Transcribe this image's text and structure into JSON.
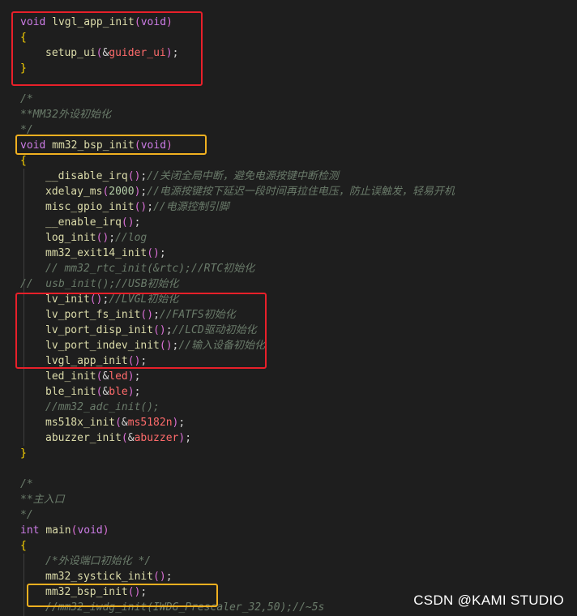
{
  "lines": [
    {
      "indent": 0,
      "tokens": [
        [
          "kw",
          "void"
        ],
        [
          "pl",
          " "
        ],
        [
          "fn",
          "lvgl_app_init"
        ],
        [
          "pn",
          "("
        ],
        [
          "kw",
          "void"
        ],
        [
          "pn",
          ")"
        ]
      ]
    },
    {
      "indent": 0,
      "tokens": [
        [
          "br",
          "{"
        ]
      ]
    },
    {
      "indent": 1,
      "tokens": [
        [
          "fn",
          "setup_ui"
        ],
        [
          "pn",
          "("
        ],
        [
          "pl",
          "&"
        ],
        [
          "var",
          "guider_ui"
        ],
        [
          "pn",
          ")"
        ],
        [
          "pl",
          ";"
        ]
      ]
    },
    {
      "indent": 0,
      "tokens": [
        [
          "br",
          "}"
        ]
      ]
    },
    {
      "indent": 0,
      "tokens": []
    },
    {
      "indent": 0,
      "tokens": [
        [
          "cm",
          "/*"
        ]
      ]
    },
    {
      "indent": 0,
      "tokens": [
        [
          "cm",
          "**MM32外设初始化"
        ]
      ]
    },
    {
      "indent": 0,
      "tokens": [
        [
          "cm",
          "*/"
        ]
      ]
    },
    {
      "indent": 0,
      "tokens": [
        [
          "kw",
          "void"
        ],
        [
          "pl",
          " "
        ],
        [
          "fn",
          "mm32_bsp_init"
        ],
        [
          "pn",
          "("
        ],
        [
          "kw",
          "void"
        ],
        [
          "pn",
          ")"
        ]
      ]
    },
    {
      "indent": 0,
      "tokens": [
        [
          "br",
          "{"
        ]
      ]
    },
    {
      "indent": 1,
      "tokens": [
        [
          "fn",
          "__disable_irq"
        ],
        [
          "pn",
          "()"
        ],
        [
          "pl",
          ";"
        ],
        [
          "cm",
          "//关闭全局中断，避免电源按键中断检测"
        ]
      ]
    },
    {
      "indent": 1,
      "tokens": [
        [
          "fn",
          "xdelay_ms"
        ],
        [
          "pn",
          "("
        ],
        [
          "num",
          "2000"
        ],
        [
          "pn",
          ")"
        ],
        [
          "pl",
          ";"
        ],
        [
          "cm",
          "//电源按键按下延迟一段时间再拉住电压，防止误触发，轻易开机"
        ]
      ]
    },
    {
      "indent": 1,
      "tokens": [
        [
          "fn",
          "misc_gpio_init"
        ],
        [
          "pn",
          "()"
        ],
        [
          "pl",
          ";"
        ],
        [
          "cm",
          "//电源控制引脚"
        ]
      ]
    },
    {
      "indent": 1,
      "tokens": [
        [
          "fn",
          "__enable_irq"
        ],
        [
          "pn",
          "()"
        ],
        [
          "pl",
          ";"
        ]
      ]
    },
    {
      "indent": 1,
      "tokens": [
        [
          "fn",
          "log_init"
        ],
        [
          "pn",
          "()"
        ],
        [
          "pl",
          ";"
        ],
        [
          "cm",
          "//log"
        ]
      ]
    },
    {
      "indent": 1,
      "tokens": [
        [
          "fn",
          "mm32_exit14_init"
        ],
        [
          "pn",
          "()"
        ],
        [
          "pl",
          ";"
        ]
      ]
    },
    {
      "indent": 1,
      "tokens": [
        [
          "cm",
          "// mm32_rtc_init(&rtc);//RTC初始化"
        ]
      ]
    },
    {
      "indent": 0,
      "tokens": [
        [
          "cm",
          "//  usb_init();//USB初始化"
        ]
      ]
    },
    {
      "indent": 1,
      "tokens": [
        [
          "fn",
          "lv_init"
        ],
        [
          "pn",
          "()"
        ],
        [
          "pl",
          ";"
        ],
        [
          "cm",
          "//LVGL初始化"
        ]
      ]
    },
    {
      "indent": 1,
      "tokens": [
        [
          "fn",
          "lv_port_fs_init"
        ],
        [
          "pn",
          "()"
        ],
        [
          "pl",
          ";"
        ],
        [
          "cm",
          "//FATFS初始化"
        ]
      ]
    },
    {
      "indent": 1,
      "tokens": [
        [
          "fn",
          "lv_port_disp_init"
        ],
        [
          "pn",
          "()"
        ],
        [
          "pl",
          ";"
        ],
        [
          "cm",
          "//LCD驱动初始化"
        ]
      ]
    },
    {
      "indent": 1,
      "tokens": [
        [
          "fn",
          "lv_port_indev_init"
        ],
        [
          "pn",
          "()"
        ],
        [
          "pl",
          ";"
        ],
        [
          "cm",
          "//输入设备初始化"
        ]
      ]
    },
    {
      "indent": 1,
      "tokens": [
        [
          "fn",
          "lvgl_app_init"
        ],
        [
          "pn",
          "()"
        ],
        [
          "pl",
          ";"
        ]
      ]
    },
    {
      "indent": 1,
      "tokens": [
        [
          "fn",
          "led_init"
        ],
        [
          "pn",
          "("
        ],
        [
          "pl",
          "&"
        ],
        [
          "var",
          "led"
        ],
        [
          "pn",
          ")"
        ],
        [
          "pl",
          ";"
        ]
      ]
    },
    {
      "indent": 1,
      "tokens": [
        [
          "fn",
          "ble_init"
        ],
        [
          "pn",
          "("
        ],
        [
          "pl",
          "&"
        ],
        [
          "var",
          "ble"
        ],
        [
          "pn",
          ")"
        ],
        [
          "pl",
          ";"
        ]
      ]
    },
    {
      "indent": 1,
      "tokens": [
        [
          "cm",
          "//mm32_adc_init();"
        ]
      ]
    },
    {
      "indent": 1,
      "tokens": [
        [
          "fn",
          "ms518x_init"
        ],
        [
          "pn",
          "("
        ],
        [
          "pl",
          "&"
        ],
        [
          "var",
          "ms5182n"
        ],
        [
          "pn",
          ")"
        ],
        [
          "pl",
          ";"
        ]
      ]
    },
    {
      "indent": 1,
      "tokens": [
        [
          "fn",
          "abuzzer_init"
        ],
        [
          "pn",
          "("
        ],
        [
          "pl",
          "&"
        ],
        [
          "var",
          "abuzzer"
        ],
        [
          "pn",
          ")"
        ],
        [
          "pl",
          ";"
        ]
      ]
    },
    {
      "indent": 0,
      "tokens": [
        [
          "br",
          "}"
        ]
      ]
    },
    {
      "indent": 0,
      "tokens": []
    },
    {
      "indent": 0,
      "tokens": [
        [
          "cm",
          "/*"
        ]
      ]
    },
    {
      "indent": 0,
      "tokens": [
        [
          "cm",
          "**主入口"
        ]
      ]
    },
    {
      "indent": 0,
      "tokens": [
        [
          "cm",
          "*/"
        ]
      ]
    },
    {
      "indent": 0,
      "tokens": [
        [
          "kw",
          "int"
        ],
        [
          "pl",
          " "
        ],
        [
          "fn",
          "main"
        ],
        [
          "pn",
          "("
        ],
        [
          "kw",
          "void"
        ],
        [
          "pn",
          ")"
        ]
      ]
    },
    {
      "indent": 0,
      "tokens": [
        [
          "br",
          "{"
        ]
      ]
    },
    {
      "indent": 1,
      "tokens": [
        [
          "cm",
          "/*外设端口初始化 */"
        ]
      ]
    },
    {
      "indent": 1,
      "tokens": [
        [
          "fn",
          "mm32_systick_init"
        ],
        [
          "pn",
          "()"
        ],
        [
          "pl",
          ";"
        ]
      ]
    },
    {
      "indent": 1,
      "tokens": [
        [
          "fn",
          "mm32_bsp_init"
        ],
        [
          "pn",
          "()"
        ],
        [
          "pl",
          ";"
        ]
      ]
    },
    {
      "indent": 1,
      "tokens": [
        [
          "cm",
          "//mm32_iwdg_init(IWDG_Prescaler_32,50);//~5s"
        ]
      ]
    }
  ],
  "colors": {
    "background": "#1e1e1e",
    "highlight_red": "#e8202a",
    "highlight_orange": "#f0b020",
    "keyword": "#cc7ce6",
    "function": "#dcdcaa",
    "number": "#b5cea8",
    "variable": "#ff6b6b",
    "comment": "#6a7b6a"
  },
  "watermark": "CSDN @KAMI STUDIO"
}
